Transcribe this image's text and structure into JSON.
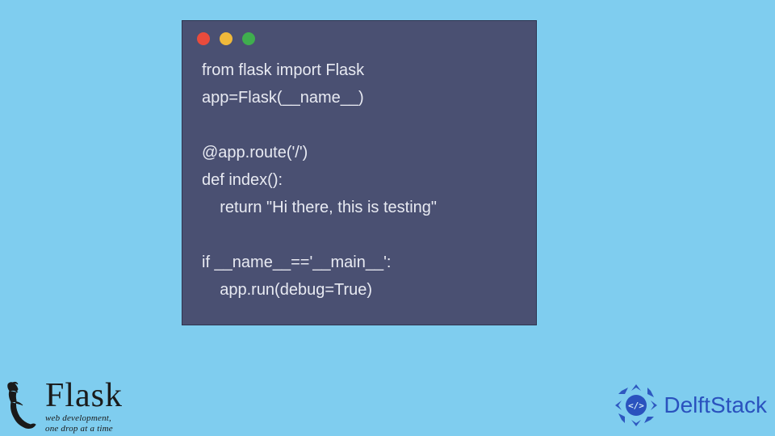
{
  "code": {
    "line1": "from flask import Flask",
    "line2": "app=Flask(__name__)",
    "line3": "",
    "line4": "@app.route('/')",
    "line5": "def index():",
    "line6": "    return \"Hi there, this is testing\"",
    "line7": "",
    "line8": "if __name__=='__main__':",
    "line9": "    app.run(debug=True)"
  },
  "flask_logo": {
    "title": "Flask",
    "subtitle1": "web development,",
    "subtitle2": "one drop at a time"
  },
  "delft_logo": {
    "name": "DelftStack",
    "badge": "</>"
  },
  "colors": {
    "page_bg": "#7fcdef",
    "window_bg": "#4a5072",
    "code_text": "#e8eaf2",
    "dot_red": "#e94b3c",
    "dot_yellow": "#f0b93a",
    "dot_green": "#3fae4e",
    "delft_blue": "#2a52be"
  }
}
